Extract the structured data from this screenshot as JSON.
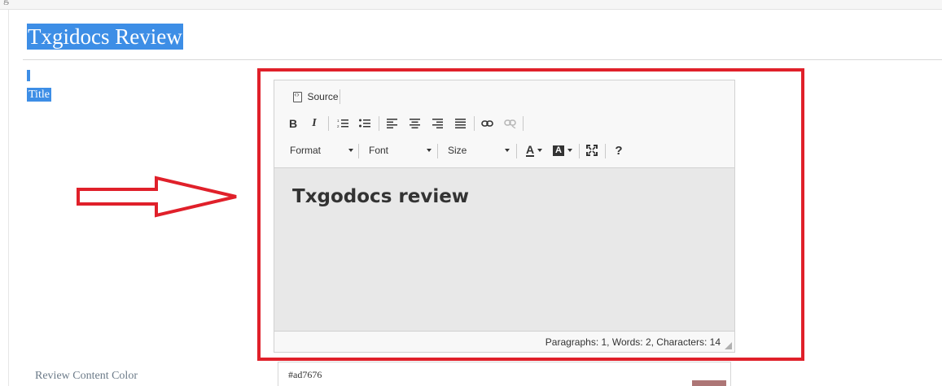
{
  "top_glyph": "g",
  "page": {
    "title": "Txgidocs Review",
    "field_title_label": "Title"
  },
  "editor": {
    "toolbar": {
      "source_label": "Source",
      "bold_label": "B",
      "italic_label": "I",
      "format_label": "Format",
      "font_label": "Font",
      "size_label": "Size",
      "text_color_label": "A",
      "bg_color_label": "A",
      "help_label": "?"
    },
    "content_heading": "Txgodocs review",
    "status": "Paragraphs: 1, Words: 2, Characters: 14"
  },
  "review_color": {
    "label": "Review Content Color",
    "value": "#ad7676",
    "swatch_color": "#ad7676"
  },
  "colors": {
    "selection": "#3d8ee6",
    "highlight_red": "#e0202a"
  }
}
